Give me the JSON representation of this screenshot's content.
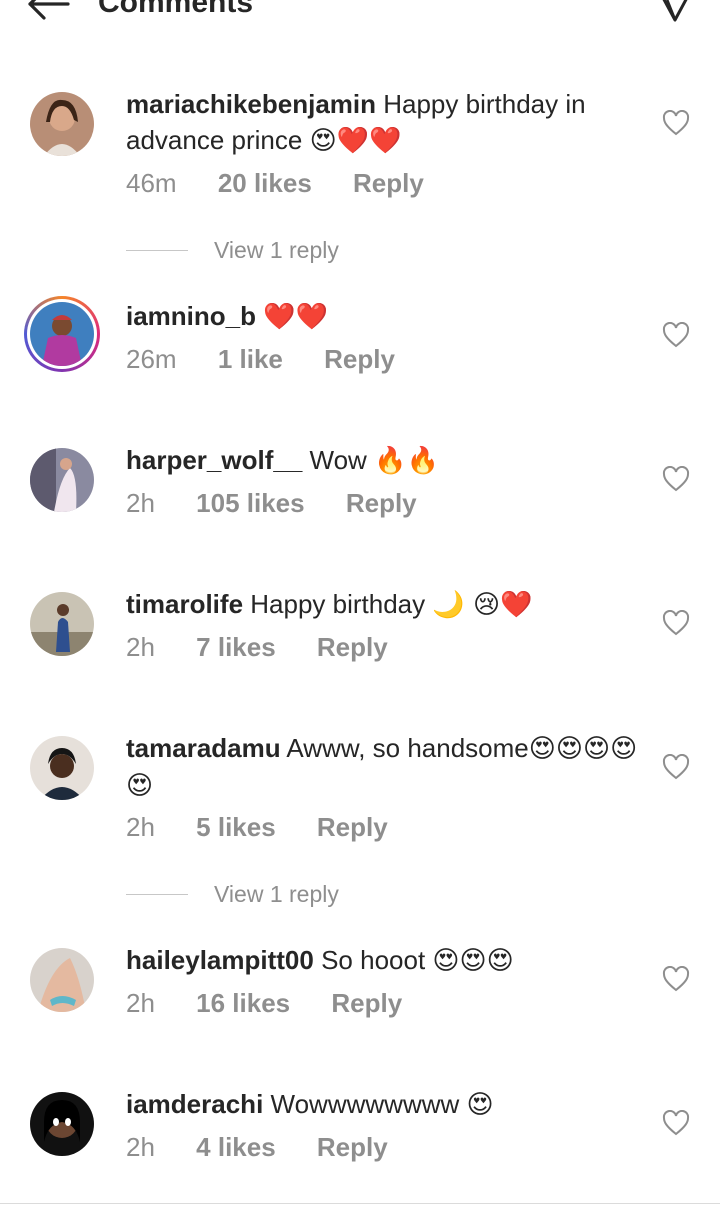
{
  "header": {
    "title": "Comments"
  },
  "comments": [
    {
      "username": "mariachikebenjamin",
      "text": "Happy birthday in advance prince",
      "emoji": "😍❤️❤️",
      "time": "46m",
      "likes": "20 likes",
      "reply": "Reply",
      "view_replies": "View 1 reply"
    },
    {
      "username": "iamnino_b",
      "text": "",
      "emoji": "❤️❤️",
      "time": "26m",
      "likes": "1 like",
      "reply": "Reply"
    },
    {
      "username": "harper_wolf__",
      "text": "Wow",
      "emoji": "🔥🔥",
      "time": "2h",
      "likes": "105 likes",
      "reply": "Reply"
    },
    {
      "username": "timarolife",
      "text": "Happy birthday",
      "emoji": "🌙 😢❤️",
      "time": "2h",
      "likes": "7 likes",
      "reply": "Reply"
    },
    {
      "username": "tamaradamu",
      "text": "Awww, so handsome",
      "emoji": "😍😍😍😍😍",
      "time": "2h",
      "likes": "5 likes",
      "reply": "Reply",
      "view_replies": "View 1 reply"
    },
    {
      "username": "haileylampitt00",
      "text": "So hooot",
      "emoji": "😍😍😍",
      "time": "2h",
      "likes": "16 likes",
      "reply": "Reply"
    },
    {
      "username": "iamderachi",
      "text": "Wowwwwwwww",
      "emoji": "😍",
      "time": "2h",
      "likes": "4 likes",
      "reply": "Reply"
    }
  ],
  "icons": {
    "back": "back-arrow-icon",
    "send": "send-icon",
    "like": "heart-outline-icon"
  },
  "colors": {
    "text": "#262626",
    "secondary": "#8e8e8e",
    "divider": "#dbdbdb"
  }
}
